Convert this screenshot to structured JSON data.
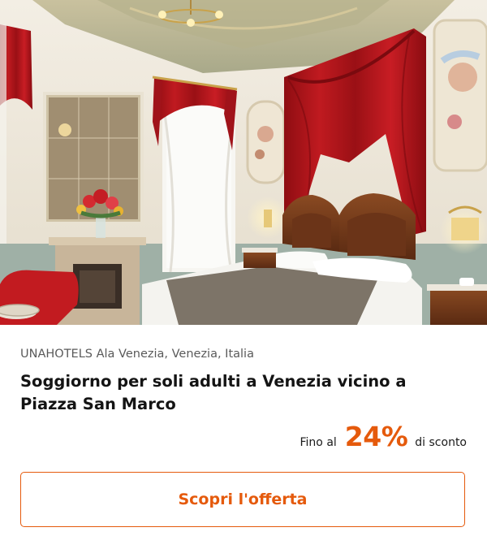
{
  "offer": {
    "location": "UNAHOTELS Ala Venezia, Venezia, Italia",
    "title": "Soggiorno per soli adulti a Venezia vicino a Piazza San Marco",
    "discount_prefix": "Fino al",
    "discount_value": "24%",
    "discount_suffix": "di sconto",
    "cta_label": "Scopri l'offerta"
  },
  "colors": {
    "accent": "#e55a0c",
    "curtain": "#b3151b",
    "wall": "#f2ede3",
    "wood": "#7a3a1a"
  }
}
